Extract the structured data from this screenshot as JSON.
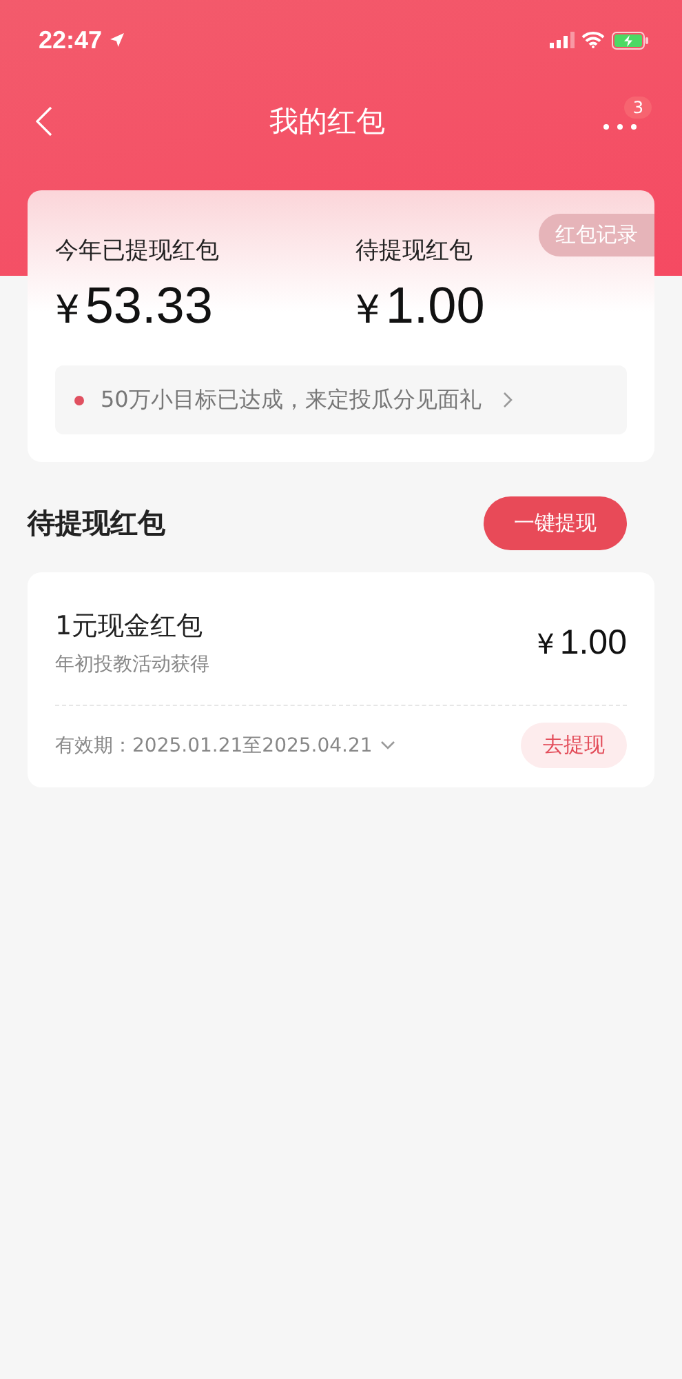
{
  "status_bar": {
    "time": "22:47"
  },
  "nav": {
    "title": "我的红包",
    "badge": "3"
  },
  "summary": {
    "record_button": "红包记录",
    "stats": [
      {
        "label": "今年已提现红包",
        "currency": "¥",
        "amount": "53.33"
      },
      {
        "label": "待提现红包",
        "currency": "¥",
        "amount": "1.00"
      }
    ],
    "notice": "50万小目标已达成，来定投瓜分见面礼"
  },
  "section": {
    "title": "待提现红包",
    "action": "一键提现"
  },
  "items": [
    {
      "name": "1元现金红包",
      "source": "年初投教活动获得",
      "currency": "¥",
      "amount": "1.00",
      "validity": "有效期：2025.01.21至2025.04.21",
      "action": "去提现"
    }
  ]
}
